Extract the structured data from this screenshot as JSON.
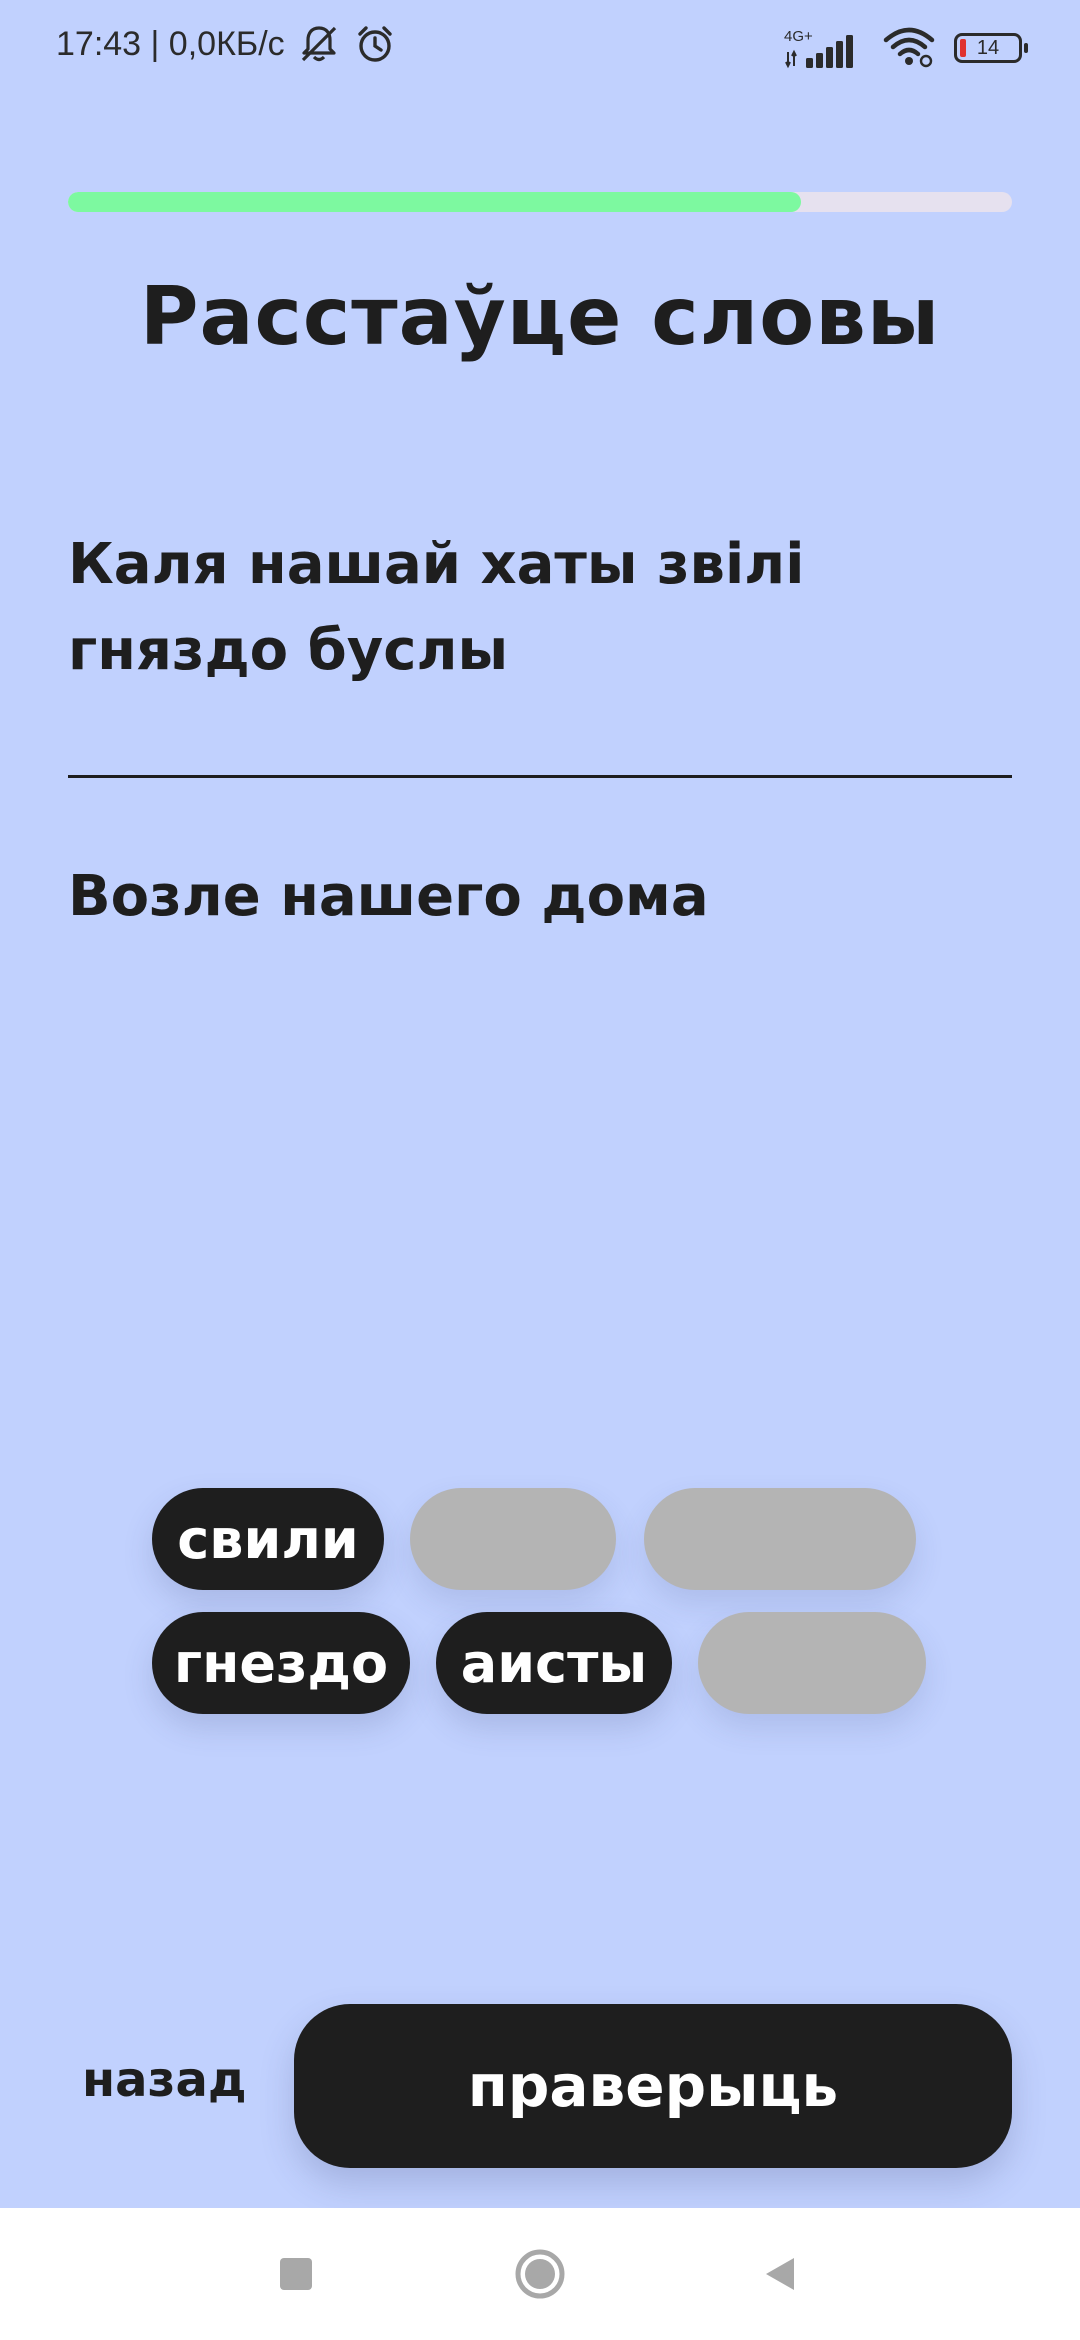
{
  "status_bar": {
    "time_speed": "17:43 | 0,0КБ/с",
    "network_type": "4G+",
    "battery_level": "14",
    "icons": [
      "bell-muted-icon",
      "alarm-icon",
      "signal-icon",
      "wifi-icon",
      "battery-icon"
    ]
  },
  "progress": {
    "fraction": 0.777,
    "fill_color": "#7df9a0",
    "track_color": "#e6e1ef"
  },
  "exercise": {
    "title": "Расстаўце словы",
    "source_sentence": "Каля нашай хаты звілі гняздо буслы",
    "answer_text": "Возле нашего дома"
  },
  "word_bank": {
    "chips": [
      {
        "label": "свили",
        "state": "available"
      },
      {
        "label": "",
        "state": "used"
      },
      {
        "label": "",
        "state": "used"
      },
      {
        "label": "гнездо",
        "state": "available"
      },
      {
        "label": "аисты",
        "state": "available"
      },
      {
        "label": "",
        "state": "used"
      }
    ]
  },
  "actions": {
    "back_label": "назад",
    "check_label": "праверыць"
  },
  "nav_bar": {
    "icons": [
      "recent-apps-icon",
      "home-icon",
      "back-icon"
    ]
  },
  "colors": {
    "background": "#c1d1fe",
    "primary_dark": "#1e1e1e",
    "chip_empty": "#b4b4b4"
  }
}
